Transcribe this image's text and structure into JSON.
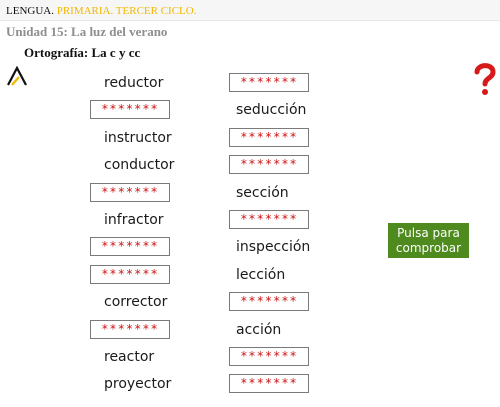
{
  "header": {
    "subject": "LENGUA.",
    "level": "PRIMARIA. TERCER CICLO."
  },
  "unit_title": "Unidad 15: La luz del verano",
  "topic_title": "Ortografía: La c y cc",
  "check_button": {
    "line1": "Pulsa para",
    "line2": "comprobar"
  },
  "placeholder": "*******",
  "left_column": [
    {
      "type": "word",
      "text": "reductor"
    },
    {
      "type": "input",
      "text": "*******"
    },
    {
      "type": "word",
      "text": "instructor"
    },
    {
      "type": "word",
      "text": "conductor"
    },
    {
      "type": "input",
      "text": "*******"
    },
    {
      "type": "word",
      "text": "infractor"
    },
    {
      "type": "input",
      "text": "*******"
    },
    {
      "type": "input",
      "text": "*******"
    },
    {
      "type": "word",
      "text": "corrector"
    },
    {
      "type": "input",
      "text": "*******"
    },
    {
      "type": "word",
      "text": "reactor"
    },
    {
      "type": "word",
      "text": "proyector"
    }
  ],
  "right_column": [
    {
      "type": "input",
      "text": "*******"
    },
    {
      "type": "word",
      "text": "seducción"
    },
    {
      "type": "input",
      "text": "*******"
    },
    {
      "type": "input",
      "text": "*******"
    },
    {
      "type": "word",
      "text": "sección"
    },
    {
      "type": "input",
      "text": "*******"
    },
    {
      "type": "word",
      "text": "inspección"
    },
    {
      "type": "word",
      "text": "lección"
    },
    {
      "type": "input",
      "text": "*******"
    },
    {
      "type": "word",
      "text": "acción"
    },
    {
      "type": "input",
      "text": "*******"
    },
    {
      "type": "input",
      "text": "*******"
    }
  ],
  "colors": {
    "accent_yellow": "#f0b800",
    "placeholder_red": "#cc1111",
    "button_green": "#4e8a1e",
    "help_red": "#d61a1a"
  },
  "icons": {
    "logo": "triangle-logo-icon",
    "help": "question-mark-icon"
  }
}
